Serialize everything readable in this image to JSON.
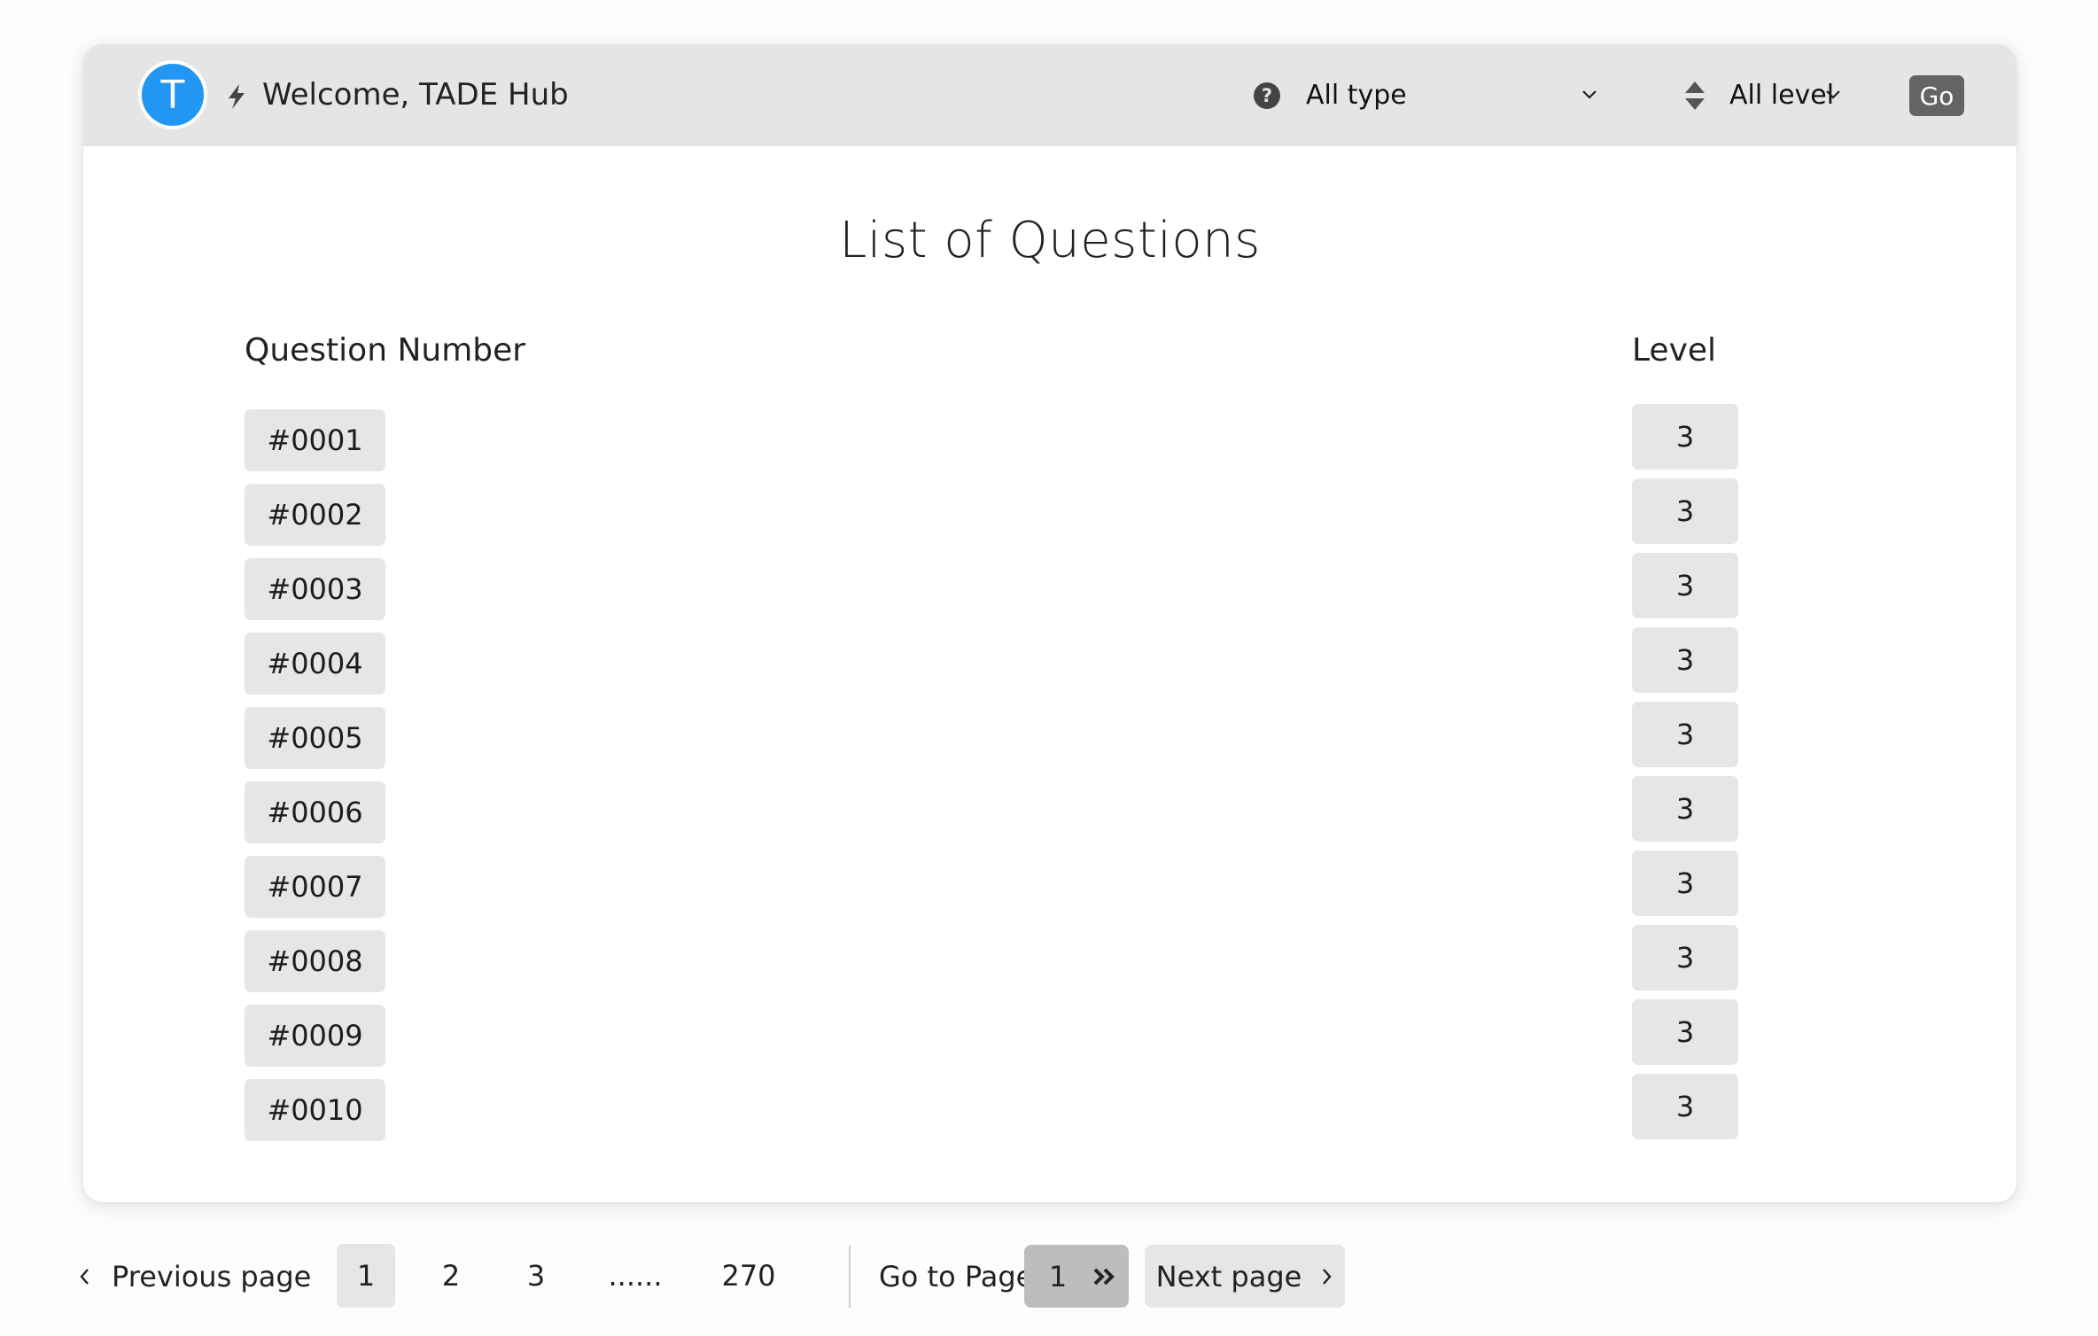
{
  "header": {
    "avatar_initial": "T",
    "welcome_text": "Welcome, TADE Hub",
    "type_filter": {
      "selected": "All type"
    },
    "level_filter": {
      "selected": "All level"
    },
    "go_label": "Go"
  },
  "main": {
    "title": "List of Questions",
    "columns": {
      "question": "Question Number",
      "level": "Level"
    },
    "rows": [
      {
        "number": "#0001",
        "level": "3"
      },
      {
        "number": "#0002",
        "level": "3"
      },
      {
        "number": "#0003",
        "level": "3"
      },
      {
        "number": "#0004",
        "level": "3"
      },
      {
        "number": "#0005",
        "level": "3"
      },
      {
        "number": "#0006",
        "level": "3"
      },
      {
        "number": "#0007",
        "level": "3"
      },
      {
        "number": "#0008",
        "level": "3"
      },
      {
        "number": "#0009",
        "level": "3"
      },
      {
        "number": "#0010",
        "level": "3"
      }
    ]
  },
  "pagination": {
    "previous_label": "Previous page",
    "pages": [
      "1",
      "2",
      "3",
      "......",
      "270"
    ],
    "current_page": "1",
    "goto_label": "Go to Page",
    "goto_value": "1",
    "next_label": "Next page"
  },
  "colors": {
    "avatar": "#2196f3",
    "header_bg": "#e5e5e5",
    "go_button": "#646464",
    "pill_bg": "#e6e6e6",
    "goto_box": "#bdbdbd"
  },
  "icons": {
    "bolt": "lightning-bolt-icon",
    "help": "question-circle-icon",
    "sort": "sort-up-down-icon",
    "chevron": "chevron-down-icon",
    "prev": "chevron-left-icon",
    "next": "chevron-right-icon",
    "goto": "double-chevron-right-icon"
  }
}
